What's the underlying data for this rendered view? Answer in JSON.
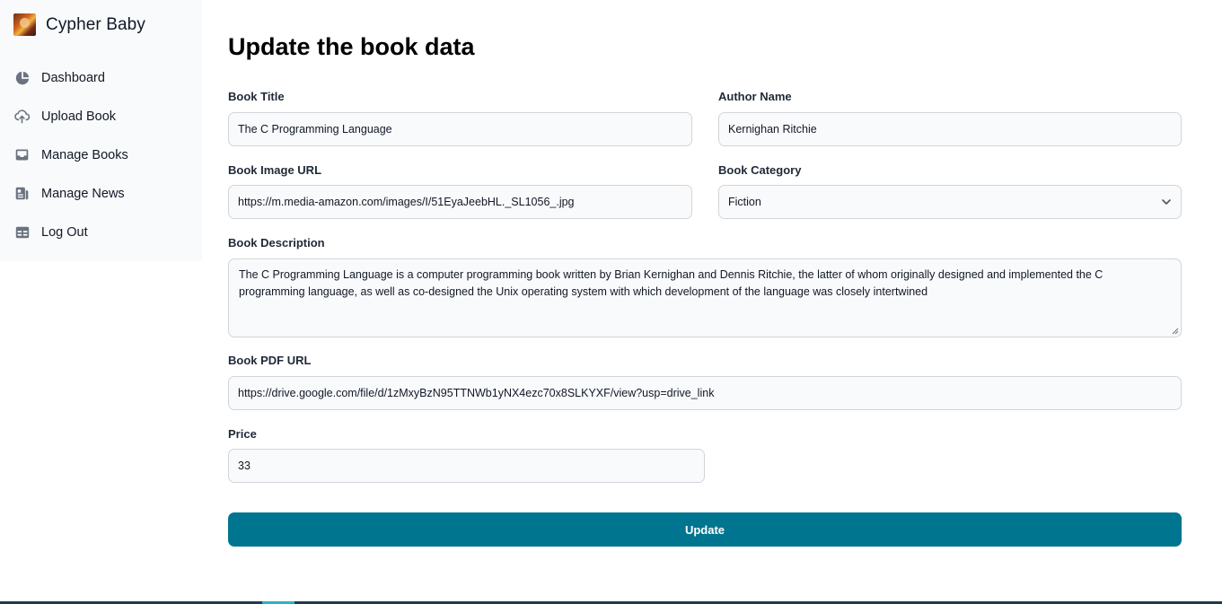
{
  "brand": {
    "name": "Cypher Baby"
  },
  "sidebar": {
    "items": [
      {
        "label": "Dashboard",
        "icon": "pie-chart-icon"
      },
      {
        "label": "Upload Book",
        "icon": "cloud-upload-icon"
      },
      {
        "label": "Manage Books",
        "icon": "inbox-icon"
      },
      {
        "label": "Manage News",
        "icon": "news-icon"
      },
      {
        "label": "Log Out",
        "icon": "table-icon"
      }
    ]
  },
  "main": {
    "title": "Update the book data",
    "form": {
      "book_title": {
        "label": "Book Title",
        "value": "The C Programming Language"
      },
      "author_name": {
        "label": "Author Name",
        "value": "Kernighan Ritchie"
      },
      "image_url": {
        "label": "Book Image URL",
        "value": "https://m.media-amazon.com/images/I/51EyaJeebHL._SL1056_.jpg"
      },
      "category": {
        "label": "Book Category",
        "value": "Fiction"
      },
      "description": {
        "label": "Book Description",
        "value": "The C Programming Language is a computer programming book written by Brian Kernighan and Dennis Ritchie, the latter of whom originally designed and implemented the C programming language, as well as co-designed the Unix operating system with which development of the language was closely intertwined"
      },
      "pdf_url": {
        "label": "Book PDF URL",
        "value": "https://drive.google.com/file/d/1zMxyBzN95TTNWb1yNX4ezc70x8SLKYXF/view?usp=drive_link"
      },
      "price": {
        "label": "Price",
        "value": "33"
      },
      "submit_label": "Update"
    }
  },
  "colors": {
    "accent": "#00758f",
    "sidebar_bg": "#f9fafb",
    "input_bg": "#f9fafb",
    "input_border": "#d1d5db"
  }
}
